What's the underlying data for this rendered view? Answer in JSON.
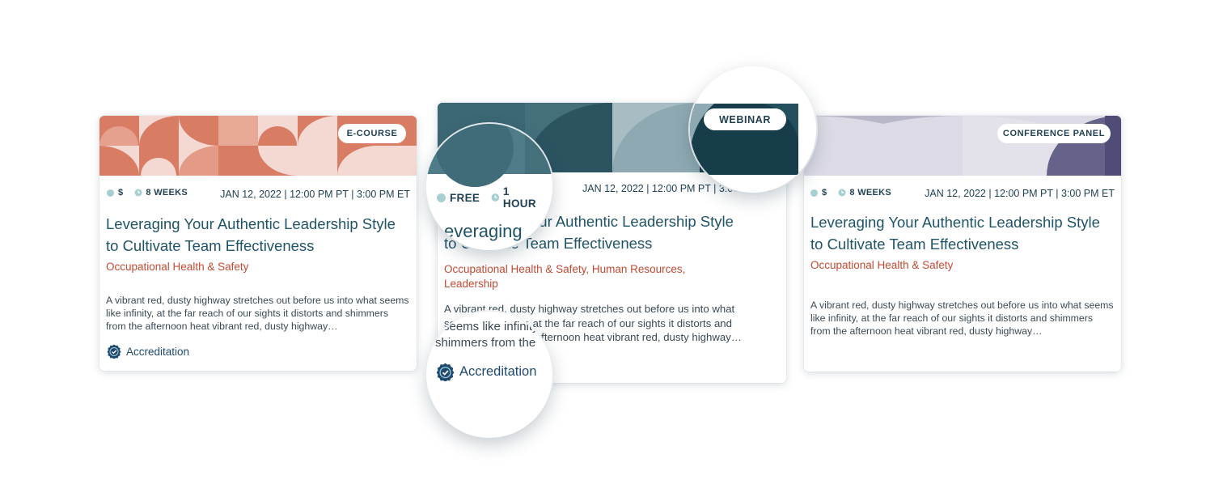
{
  "cards": [
    {
      "badge": "E-COURSE",
      "price": "$",
      "duration": "8 WEEKS",
      "date": "JAN 12, 2022 | 12:00 PM PT | 3:00 PM ET",
      "title_line1": "Leveraging Your Authentic Leadership Style",
      "title_line2": "to Cultivate Team Effectiveness",
      "category": "Occupational Health & Safety",
      "description": "A vibrant red, dusty highway stretches out before us into what seems like infinity, at the far reach of our sights it distorts and shimmers from the afternoon heat vibrant red, dusty highway…",
      "accreditation": "Accreditation",
      "colors": {
        "banner_a": "#d97c64",
        "banner_b": "#f4d9d2"
      }
    },
    {
      "badge": "WEBINAR",
      "price": "FREE",
      "duration": "1 HOUR",
      "date": "JAN 12, 2022 | 12:00 PM PT | 3:00 PM ET",
      "title_line1": "Leveraging Your Authentic Leadership Style",
      "title_line2": "to Cultivate Team Effectiveness",
      "category": "Occupational Health & Safety, Human Resources, Leadership",
      "description": "A vibrant red, dusty highway stretches out before us into what seems like infinity, at the far reach of our sights it distorts and shimmers from the afternoon heat vibrant red, dusty highway…",
      "accreditation": "Accreditation",
      "colors": {
        "banner_a": "#44707c",
        "banner_b": "#173d4a"
      }
    },
    {
      "badge": "CONFERENCE PANEL",
      "price": "$",
      "duration": "8 WEEKS",
      "date": "JAN 12, 2022 | 12:00 PM PT | 3:00 PM ET",
      "title_line1": "Leveraging Your Authentic Leadership Style",
      "title_line2": "to Cultivate Team Effectiveness",
      "category": "Occupational Health & Safety",
      "description": "A vibrant red, dusty highway stretches out before us into what seems like infinity, at the far reach of our sights it distorts and shimmers from the afternoon heat vibrant red, dusty highway…",
      "colors": {
        "banner_a": "#dcdbe5",
        "banner_b": "#4f4c78"
      }
    }
  ],
  "zoom": {
    "meta_title_fragment": "everaging",
    "desc_fragment_1": "seems like infinity",
    "desc_fragment_2": "shimmers from the"
  },
  "icons": {
    "accreditation": "badge-check-icon",
    "duration": "clock-icon"
  }
}
